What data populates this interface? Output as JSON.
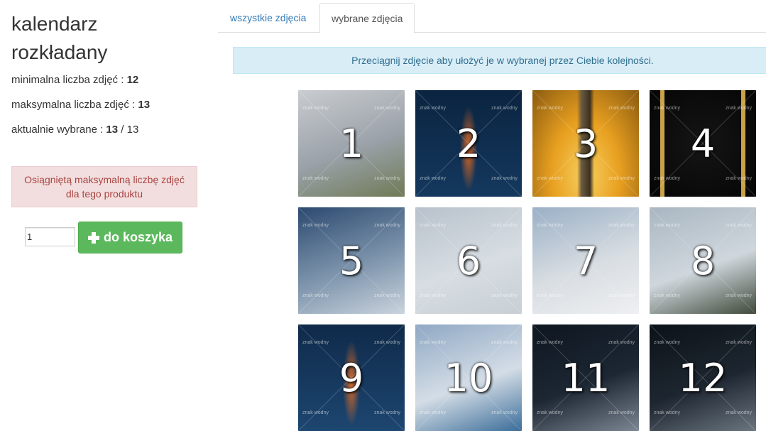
{
  "product": {
    "title": "kalendarz rozkładany",
    "min_label": "minimalna liczba zdjęć : ",
    "min_value": "12",
    "max_label": "maksymalna liczba zdjęć : ",
    "max_value": "13",
    "current_label": "aktualnie wybrane : ",
    "current_value": "13",
    "current_sep": " / ",
    "current_total": "13",
    "max_reached_message": "Osiągniętą maksymalną liczbę zdjęć dla tego produktu",
    "quantity_value": "1",
    "add_to_cart_label": "do koszyka"
  },
  "tabs": {
    "all_label": "wszystkie zdjęcia",
    "selected_label": "wybrane zdjęcia"
  },
  "hint": "Przeciągnij zdjęcie aby ułożyć je w wybranej przez Ciebie kolejności.",
  "watermark_text": "znak wodny",
  "photos": [
    {
      "number": "1",
      "scene": "helicopter on snow",
      "colors": [
        "#c9ccd0",
        "#9aa1a8",
        "#6f7a56"
      ]
    },
    {
      "number": "2",
      "scene": "rocket launch night",
      "colors": [
        "#0b2440",
        "#14385e",
        "#e06a24"
      ]
    },
    {
      "number": "3",
      "scene": "rocket launch smoke",
      "colors": [
        "#8a5a10",
        "#e8a020",
        "#f6d060"
      ]
    },
    {
      "number": "4",
      "scene": "space station",
      "colors": [
        "#050505",
        "#151515",
        "#c9a24a"
      ]
    },
    {
      "number": "5",
      "scene": "clouds aerial",
      "colors": [
        "#2c4a70",
        "#7d94ac",
        "#c9d3dd"
      ]
    },
    {
      "number": "6",
      "scene": "snow field with people",
      "colors": [
        "#b8c2cc",
        "#d7dde2",
        "#c8cfd5"
      ]
    },
    {
      "number": "7",
      "scene": "clouds sky",
      "colors": [
        "#9ab0c6",
        "#d8dde2",
        "#eef0f2"
      ]
    },
    {
      "number": "8",
      "scene": "helicopter in flight snow",
      "colors": [
        "#a9b6c1",
        "#cfd7dd",
        "#3f4a3a"
      ]
    },
    {
      "number": "9",
      "scene": "rocket launch night",
      "colors": [
        "#0f2a4a",
        "#1d4670",
        "#d96a28"
      ]
    },
    {
      "number": "10",
      "scene": "vehicles on snow",
      "colors": [
        "#8fa8c4",
        "#d4dde6",
        "#3b6d99"
      ]
    },
    {
      "number": "11",
      "scene": "spacecraft dark",
      "colors": [
        "#0e1620",
        "#1c2733",
        "#7d8794"
      ]
    },
    {
      "number": "12",
      "scene": "spacecraft dark",
      "colors": [
        "#0c1218",
        "#1d2630",
        "#6b7580"
      ]
    }
  ]
}
